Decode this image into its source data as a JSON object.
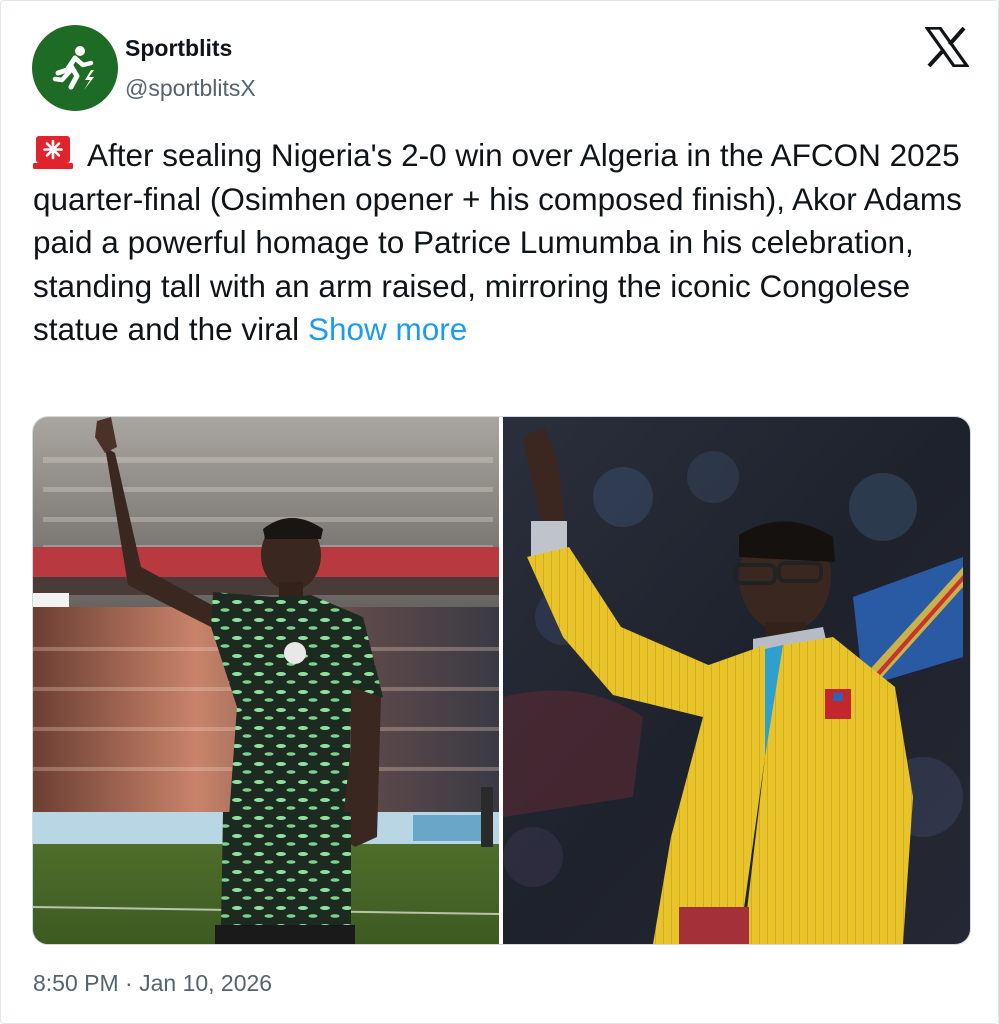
{
  "author": {
    "name": "Sportblits",
    "handle": "@sportblitsX",
    "avatar_icon": "runner-bolt-icon",
    "avatar_color": "#1e6b25"
  },
  "platform_icon": "x-logo-icon",
  "tweet": {
    "emoji": "siren-icon",
    "text": "After sealing Nigeria's 2-0 win over Algeria in the AFCON 2025 quarter-final (Osimhen opener + his composed finish), Akor Adams paid a powerful homage to Patrice Lumumba in his celebration, standing tall with an arm raised, mirroring the iconic Congolese statue and the viral",
    "show_more": "Show more"
  },
  "media": [
    {
      "name": "player-celebration-photo"
    },
    {
      "name": "man-yellow-suit-photo"
    }
  ],
  "timestamp": "8:50 PM · Jan 10, 2026",
  "colors": {
    "link": "#1d9bf0",
    "secondary_text": "#536471",
    "primary_text": "#0f1419"
  }
}
